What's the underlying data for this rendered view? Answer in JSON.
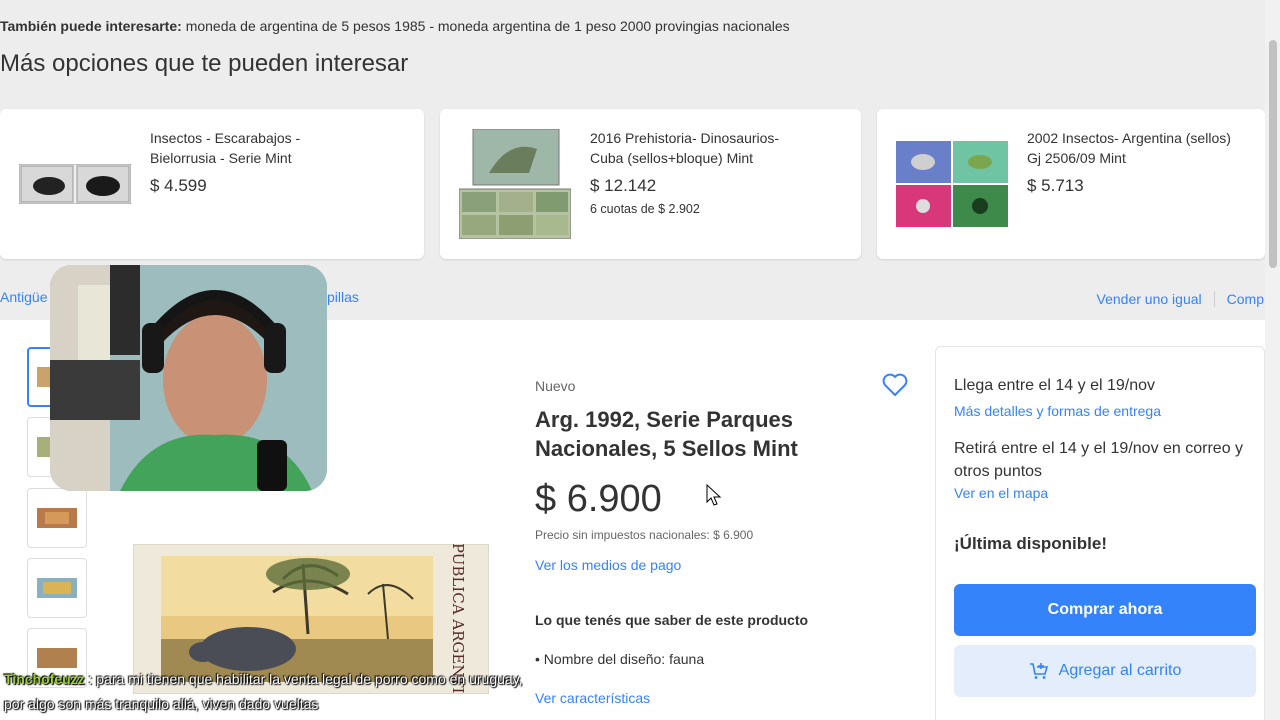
{
  "also": {
    "label": "También puede interesarte:",
    "text": "moneda de argentina de 5 pesos 1985 - moneda argentina de 1 peso 2000 provingias nacionales"
  },
  "more_options": {
    "title": "Más opciones que te pueden interesar",
    "cards": [
      {
        "title": "Insectos - Escarabajos - Bielorrusia - Serie Mint",
        "price": "$ 4.599",
        "installments": ""
      },
      {
        "title": "2016 Prehistoria- Dinosaurios- Cuba (sellos+bloque) Mint",
        "price": "$ 12.142",
        "installments": "6 cuotas de $ 2.902"
      },
      {
        "title": "2002 Insectos- Argentina (sellos) Gj 2506/09 Mint",
        "price": "$ 5.713",
        "installments": ""
      }
    ]
  },
  "breadcrumb": {
    "left": "Antigüe",
    "right": "pillas"
  },
  "sell_links": {
    "sell_same": "Vender uno igual",
    "compare": "Comp"
  },
  "product": {
    "condition": "Nuevo",
    "title": "Arg. 1992, Serie Parques Nacionales, 5 Sellos Mint",
    "price": "$ 6.900",
    "tax_note": "Precio sin impuestos nacionales: $ 6.900",
    "payment_link": "Ver los medios de pago",
    "know_title": "Lo que tenés que saber de este producto",
    "feature": "Nombre del diseño: fauna",
    "features_link": "Ver características",
    "stamp_text": "REPUBLICA ARGENTINA"
  },
  "buybox": {
    "arrival": "Llega entre el 14 y el 19/nov",
    "delivery_link": "Más detalles y formas de entrega",
    "pickup": "Retirá entre el 14 y el 19/nov en correo y otros puntos",
    "map_link": "Ver en el mapa",
    "stock": "¡Última disponible!",
    "buy_now": "Comprar ahora",
    "add_cart": "Agregar al carrito"
  },
  "chat": {
    "user": "Tinchofeuzz",
    "line1": ": para mi tienen que habilitar la venta legal de porro como en uruguay,",
    "line2": "por algo son más tranquilo allá, viven dado vueltas"
  },
  "colors": {
    "accent": "#3483fa",
    "background": "#ededed",
    "chat_user": "#9bd22d"
  }
}
